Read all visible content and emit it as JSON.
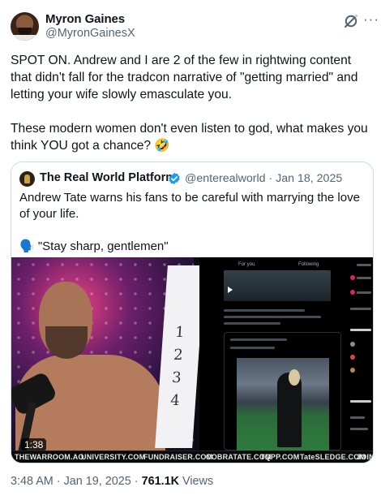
{
  "author": {
    "name": "Myron Gaines",
    "handle": "@MyronGainesX"
  },
  "tweet": {
    "paragraphs": [
      "SPOT ON. Andrew and I are 2 of the few in rightwing content that didn't fall for the tradcon narrative of \"getting married\" and letting your wife slowly emasculate you.",
      "These modern women don't even listen to god, what makes you think YOU got a chance? 🤣"
    ]
  },
  "quote": {
    "name": "The Real World Platform",
    "handle_date": "@enterealworld · Jan 18, 2025",
    "text": [
      "Andrew Tate warns his fans to be careful with marrying the love of your life.",
      "🗣️ \"Stay sharp, gentlemen\""
    ],
    "video": {
      "duration": "1:38",
      "ticker": [
        "THEWARROOM.AO",
        "UNIVERSITY.COM",
        "FUNDRAISER.COM",
        "COBRATATE.COM",
        "TQPP.COM",
        "TateSLEDGE.COM",
        "JOIN"
      ],
      "phone_tabs": [
        "For you",
        "Following"
      ],
      "board_numbers": [
        "1",
        "2",
        "3",
        "4"
      ]
    }
  },
  "meta": {
    "time": "3:48 AM · Jan 19, 2025 ·",
    "views_count": "761.1K",
    "views_label": "Views"
  },
  "icons": {
    "header_left": "grok-icon",
    "header_right": "more-options-icon",
    "verified": "verified-badge-icon"
  },
  "colors": {
    "text": "#0f1419",
    "secondary": "#536471",
    "border": "#cfd9de",
    "verified": "#1d9bf0"
  }
}
